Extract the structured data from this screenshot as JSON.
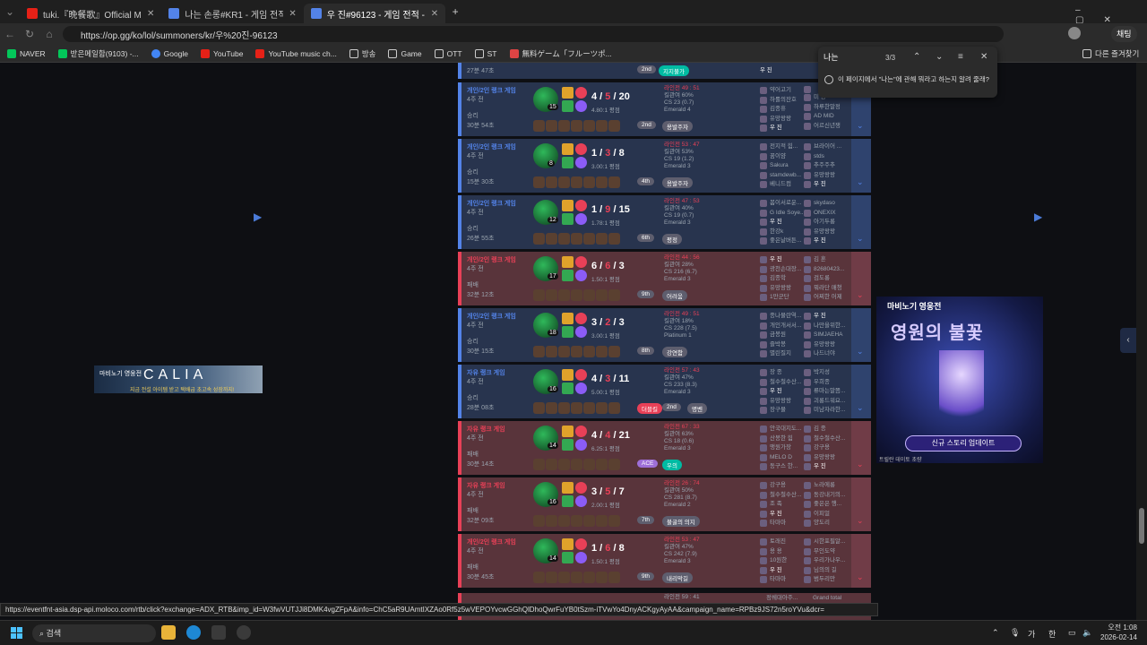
{
  "tabs": [
    {
      "title": "tuki.『晩餐歌』Official Music Vid",
      "active": false,
      "color": "#e62117"
    },
    {
      "title": "나는 손롱#KR1 - 게임 전적 - League",
      "active": false,
      "color": "#5383e8"
    },
    {
      "title": "우 진#96123 - 게임 전적 - League",
      "active": true,
      "color": "#5383e8"
    }
  ],
  "address": {
    "url": "https://op.gg/ko/lol/summoners/kr/우%20진-96123",
    "profile_label": "채팅"
  },
  "bookmarks": [
    "NAVER",
    "받은메일함(9103) -...",
    "Google",
    "YouTube",
    "YouTube music ch...",
    "방송",
    "Game",
    "OTT",
    "ST",
    "無料ゲーム「フルーツポ..."
  ],
  "other_bookmarks": "다른 즐겨찾기",
  "find": {
    "query": "나는",
    "count": "3/3",
    "message": "이 페이지에서 \"나는\"에 관해 뭐라고 하는지 알려 줄래?"
  },
  "prev_row": {
    "ago": "27분 47초",
    "badge": "2nd",
    "badge2": "지지불가",
    "me": "우 진"
  },
  "matches": [
    {
      "result": "win",
      "type": "개인/2인 랭크 게임",
      "ago": "4주 전",
      "res": "승리",
      "len": "30분 54초",
      "lvl": "15",
      "k": "4",
      "d": "5",
      "a": "20",
      "ratio": "4.80:1 평점",
      "pk": "라인전 49 : 51",
      "kp": "킬관여 60%",
      "cs": "CS 23 (0.7)",
      "tier": "Emerald 4",
      "badges": [
        {
          "t": "2nd",
          "c": "grey"
        },
        {
          "t": "용발주자",
          "c": "grey"
        }
      ],
      "blue": [
        "약어고기",
        "하롤의잔호",
        "김종휴",
        "유망왕왕",
        "우 진"
      ],
      "red": [
        "",
        "미 공",
        "하루한말정",
        "AD MID",
        "어르신년쟁"
      ]
    },
    {
      "result": "win",
      "type": "개인/2인 랭크 게임",
      "ago": "4주 전",
      "res": "승리",
      "len": "15분 30초",
      "lvl": "8",
      "k": "1",
      "d": "3",
      "a": "8",
      "ratio": "3.00:1 평점",
      "pk": "라인전 53 : 47",
      "kp": "킬관여 53%",
      "cs": "CS 19 (1.2)",
      "tier": "Emerald 3",
      "badges": [
        {
          "t": "4th",
          "c": "grey"
        },
        {
          "t": "용발주자",
          "c": "grey"
        }
      ],
      "blue": [
        "전지적 힘...",
        "꿈이얌",
        "Sakura",
        "stamdewb...",
        "베니드컴"
      ],
      "red": [
        "브라이어 ...",
        "stds",
        "추주주추",
        "유망왕왕",
        "우 진"
      ]
    },
    {
      "result": "win",
      "type": "개인/2인 랭크 게임",
      "ago": "4주 전",
      "res": "승리",
      "len": "26분 55초",
      "lvl": "12",
      "k": "1",
      "d": "9",
      "a": "15",
      "ratio": "1.78:1 평점",
      "pk": "라인전 47 : 53",
      "kp": "킬관여 40%",
      "cs": "CS 19 (0.7)",
      "tier": "Emerald 3",
      "badges": [
        {
          "t": "6th",
          "c": "grey"
        },
        {
          "t": "평정",
          "c": "grey"
        }
      ],
      "blue": [
        "봄이서로운...",
        "G Idle Soye...",
        "우 진",
        "한강k",
        "좋은날버튼..."
      ],
      "red": [
        "skydaso",
        "ONEXIX",
        "아기두롱",
        "유망왕왕",
        "우 진"
      ]
    },
    {
      "result": "loss",
      "type": "개인/2인 랭크 게임",
      "ago": "4주 전",
      "res": "패배",
      "len": "32분 12초",
      "lvl": "17",
      "k": "6",
      "d": "6",
      "a": "3",
      "ratio": "1.50:1 평점",
      "pk": "라인전 44 : 56",
      "kp": "킬관여 28%",
      "cs": "CS 216 (6.7)",
      "tier": "Emerald 3",
      "badges": [
        {
          "t": "9th",
          "c": "grey"
        },
        {
          "t": "어려움",
          "c": "grey"
        }
      ],
      "blue": [
        "우 진",
        "광천손대장...",
        "김종학",
        "유망왕왕",
        "1만군단"
      ],
      "red": [
        "김 혼",
        "82680423...",
        "검도롱",
        "뭐라단 매청",
        "어찌한 어제"
      ]
    },
    {
      "result": "win",
      "type": "개인/2인 랭크 게임",
      "ago": "4주 전",
      "res": "승리",
      "len": "30분 15초",
      "lvl": "18",
      "k": "3",
      "d": "2",
      "a": "3",
      "ratio": "3.00:1 평점",
      "pk": "라인전 49 : 51",
      "kp": "킬관여 18%",
      "cs": "CS 228 (7.5)",
      "tier": "Platinum 1",
      "badges": [
        {
          "t": "8th",
          "c": "grey"
        },
        {
          "t": "강연함",
          "c": "grey"
        }
      ],
      "blue": [
        "종나물란역...",
        "개인개서서...",
        "금봉원",
        "즐박봉",
        "별린질지"
      ],
      "red": [
        "우 진",
        "나만을위한...",
        "SIMJAEHA",
        "유망왕왕",
        "나드너야"
      ]
    },
    {
      "result": "win",
      "type": "자유 랭크 게임",
      "ago": "4주 전",
      "res": "승리",
      "len": "28분 08초",
      "lvl": "16",
      "k": "4",
      "d": "3",
      "a": "11",
      "ratio": "5.00:1 평점",
      "pk": "라인전 57 : 43",
      "kp": "킬관여 47%",
      "cs": "CS 233 (8.3)",
      "tier": "Emerald 3",
      "badges": [
        {
          "t": "더블킬",
          "c": "red"
        },
        {
          "t": "2nd",
          "c": "grey"
        },
        {
          "t": "명벤",
          "c": "grey"
        }
      ],
      "blue": [
        "장 종",
        "철수철수산...",
        "우 진",
        "유망왕왕",
        "장구물"
      ],
      "red": [
        "박지성",
        "우희종",
        "류마는말쯤...",
        "괴롱드워요...",
        "미남자라한..."
      ]
    },
    {
      "result": "loss",
      "type": "자유 랭크 게임",
      "ago": "4주 전",
      "res": "패배",
      "len": "30분 14초",
      "lvl": "14",
      "k": "4",
      "d": "4",
      "a": "21",
      "ratio": "6.25:1 평점",
      "pk": "라인전 67 : 33",
      "kp": "킬관여 63%",
      "cs": "CS 18 (0.6)",
      "tier": "Emerald 3",
      "badges": [
        {
          "t": "ACE",
          "c": "purple"
        },
        {
          "t": "우의",
          "c": "green"
        }
      ],
      "blue": [
        "안국대지도...",
        "산봉한 힘",
        "맹원가장",
        "MELO D",
        "동구스 한..."
      ],
      "red": [
        "김 종",
        "철수철수산...",
        "강구용",
        "유망왕왕",
        "우 진"
      ]
    },
    {
      "result": "loss",
      "type": "자유 랭크 게임",
      "ago": "4주 전",
      "res": "패배",
      "len": "32분 09초",
      "lvl": "16",
      "k": "3",
      "d": "5",
      "a": "7",
      "ratio": "2.00:1 평점",
      "pk": "라인전 26 : 74",
      "kp": "킬관여 50%",
      "cs": "CS 281 (8.7)",
      "tier": "Emerald 2",
      "badges": [
        {
          "t": "7th",
          "c": "grey"
        },
        {
          "t": "불굴의 의지",
          "c": "grey"
        }
      ],
      "blue": [
        "강구용",
        "철수철수산...",
        "조 족",
        "우 진",
        "타마마"
      ],
      "red": [
        "노라에롱",
        "동강내기의...",
        "좋은은 행...",
        "이피얼",
        "양도리"
      ]
    },
    {
      "result": "loss",
      "type": "개인/2인 랭크 게임",
      "ago": "4주 전",
      "res": "패배",
      "len": "30분 45초",
      "lvl": "14",
      "k": "1",
      "d": "6",
      "a": "8",
      "ratio": "1.50:1 평점",
      "pk": "라인전 53 : 47",
      "kp": "킬관여 47%",
      "cs": "CS 242 (7.9)",
      "tier": "Emerald 3",
      "badges": [
        {
          "t": "9th",
          "c": "grey"
        },
        {
          "t": "내리막길",
          "c": "grey"
        }
      ],
      "blue": [
        "토래진",
        "용 용",
        "10원한",
        "우 진",
        "타마마"
      ],
      "red": [
        "시한포필알...",
        "무인도약",
        "우리가나우...",
        "님의의 길",
        "범두리만"
      ]
    }
  ],
  "next_row": {
    "pk": "라인전 59 : 41",
    "blue": "정쉐대아주...",
    "red": "Grand total"
  },
  "ad_right": {
    "brand": "마비노기 영웅전",
    "title": "영원의 불꽃",
    "button": "신규 스토리 업데이트",
    "footer": "트릴란 데이토 초량"
  },
  "ad_left": {
    "brand": "마비노기 영웅전",
    "title": "CALIA",
    "sub": "지금 전설 아이템 받고 택배급 초고속 성장까지!"
  },
  "status_url": "https://eventfnt-asia.dsp-api.moloco.com/rtb/click?exchange=ADX_RTB&imp_id=W3fwVUTJJi8DMK4vgZFpA&info=ChC5aR9UAmtIXZAo0Rf5z5wVEPOYvcwGGhQlDhoQwrFuYB0tSzm-iTVwYo4DnyACKgyAyAA&campaign_name=RPBz9JS72n5roYVu&dcr=",
  "taskbar": {
    "search": "검색",
    "lang": "가",
    "ime": "한",
    "time": "오전 1:08",
    "date": "2026-02-14"
  }
}
